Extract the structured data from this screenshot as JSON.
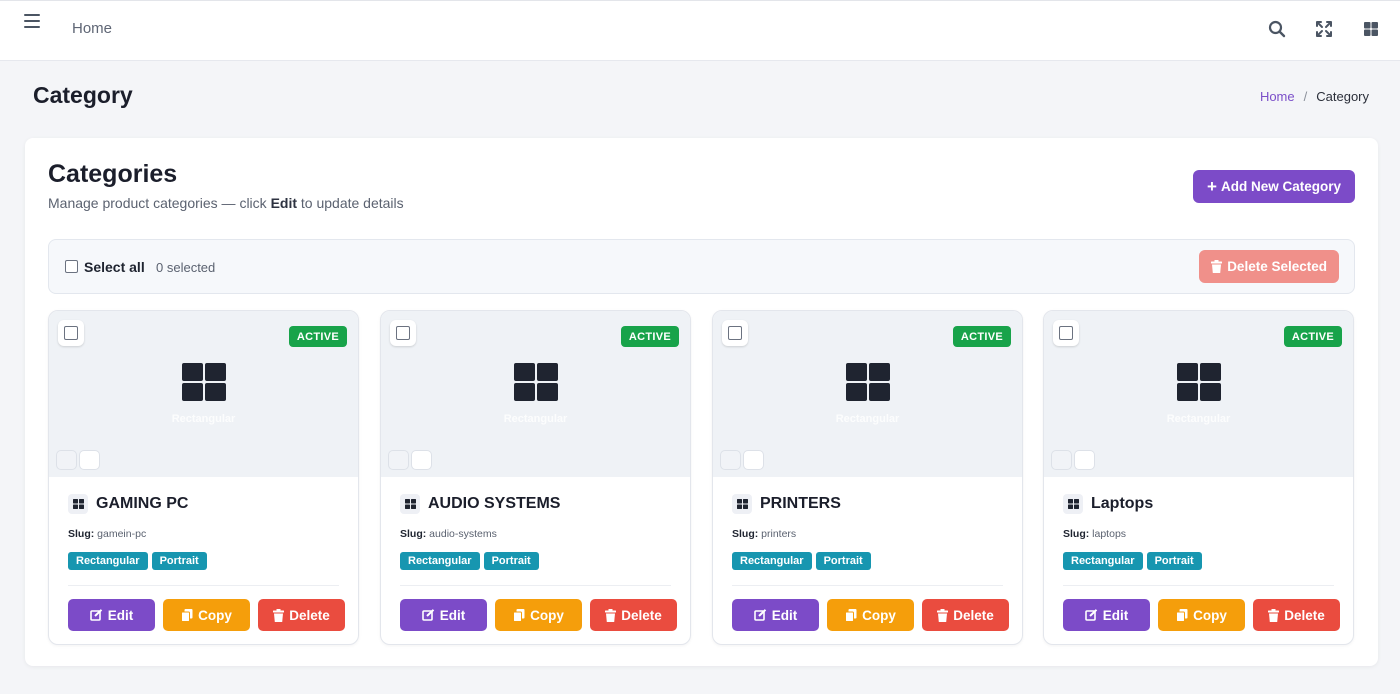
{
  "topbar": {
    "home_label": "Home",
    "icons": [
      "menu-icon",
      "search-icon",
      "fullscreen-icon",
      "apps-grid-icon"
    ]
  },
  "page": {
    "title": "Category",
    "breadcrumb": [
      {
        "label": "Home"
      },
      {
        "label": "Category"
      }
    ],
    "breadcrumb_sep": "/"
  },
  "main": {
    "heading": "Categories",
    "subtitle_pre": "Manage product categories — click",
    "subtitle_bold": "Edit",
    "subtitle_post": "to update details",
    "add_button": "Add New Category",
    "select_all_label": "Select all",
    "selected_count": "0 selected",
    "delete_selected_label": "Delete Selected"
  },
  "colors": {
    "primary": "#7c4bc8",
    "active_badge": "#18a34a",
    "tag": "#1796b0",
    "copy": "#f59e0b",
    "delete": "#ea4c3f",
    "delete_selected": "#f0908a"
  },
  "card_labels": {
    "status": "ACTIVE",
    "media_caption": "Rectangular",
    "slug_label": "Slug:",
    "edit": "Edit",
    "copy": "Copy",
    "delete": "Delete"
  },
  "cards": [
    {
      "name": "GAMING PC",
      "slug": "gamein-pc",
      "tags": [
        "Rectangular",
        "Portrait"
      ]
    },
    {
      "name": "AUDIO SYSTEMS",
      "slug": "audio-systems",
      "tags": [
        "Rectangular",
        "Portrait"
      ]
    },
    {
      "name": "PRINTERS",
      "slug": "printers",
      "tags": [
        "Rectangular",
        "Portrait"
      ]
    },
    {
      "name": "Laptops",
      "slug": "laptops",
      "tags": [
        "Rectangular",
        "Portrait"
      ]
    }
  ]
}
